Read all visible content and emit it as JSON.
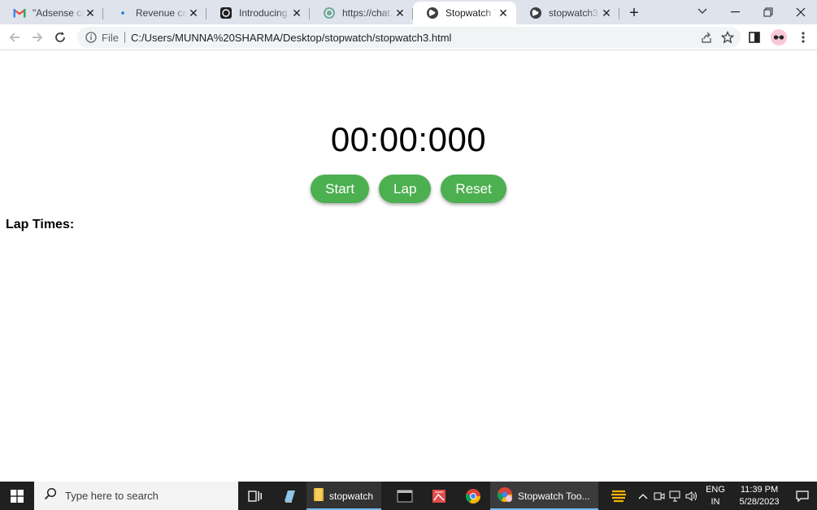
{
  "browser": {
    "tabs": [
      {
        "title": "\"Adsense calcul",
        "favicon": "gmail-icon"
      },
      {
        "title": "Revenue calcula",
        "favicon": "dot-icon"
      },
      {
        "title": "Introducing Ch",
        "favicon": "openai-icon"
      },
      {
        "title": "https://chat.op",
        "favicon": "openai-icon"
      },
      {
        "title": "Stopwatch Tool",
        "favicon": "globe-icon",
        "active": true
      },
      {
        "title": "stopwatch3.htm",
        "favicon": "globe-icon"
      }
    ],
    "new_tab": "+",
    "address": {
      "scheme_label": "File",
      "url": "C:/Users/MUNNA%20SHARMA/Desktop/stopwatch/stopwatch3.html"
    }
  },
  "page": {
    "timer": "00:00:000",
    "buttons": {
      "start": "Start",
      "lap": "Lap",
      "reset": "Reset"
    },
    "laps_heading": "Lap Times:",
    "button_color": "#4caf50"
  },
  "taskbar": {
    "search_placeholder": "Type here to search",
    "folder_label": "stopwatch",
    "chrome_window_label": "Stopwatch Too...",
    "lang_line1": "ENG",
    "lang_line2": "IN",
    "time": "11:39 PM",
    "date": "5/28/2023"
  }
}
